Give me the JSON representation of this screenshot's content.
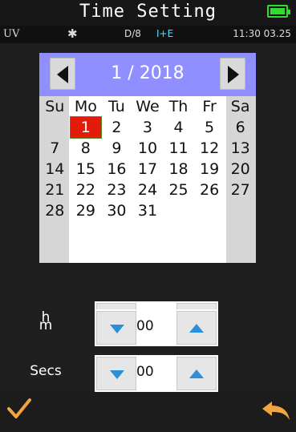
{
  "title": "Time Setting",
  "status": {
    "mode": "UV",
    "bluetooth": "bluetooth-icon",
    "geometry": "D/8",
    "specular": "I+E",
    "clock": "11:30 03.25"
  },
  "calendar": {
    "month_label": "1  /  2018",
    "weekdays": [
      "Su",
      "Mo",
      "Tu",
      "We",
      "Th",
      "Fr",
      "Sa"
    ],
    "weeks": [
      [
        "",
        "1",
        "2",
        "3",
        "4",
        "5",
        "6"
      ],
      [
        "7",
        "8",
        "9",
        "10",
        "11",
        "12",
        "13"
      ],
      [
        "14",
        "15",
        "16",
        "17",
        "18",
        "19",
        "20"
      ],
      [
        "21",
        "22",
        "23",
        "24",
        "25",
        "26",
        "27"
      ],
      [
        "28",
        "29",
        "30",
        "31",
        "",
        "",
        ""
      ],
      [
        "",
        "",
        "",
        "",
        "",
        "",
        ""
      ],
      [
        "",
        "",
        "",
        "",
        "",
        "",
        ""
      ]
    ],
    "selected_day": "1"
  },
  "time": {
    "hours_label": "h",
    "hours_value": "00",
    "minutes_label": "m",
    "minutes_value": "00",
    "seconds_label": "Secs",
    "seconds_value": "00"
  },
  "colors": {
    "header": "#8f8fff",
    "selected": "#e31b0a",
    "arrow": "#2b8fd9",
    "confirm": "#f0a540"
  }
}
